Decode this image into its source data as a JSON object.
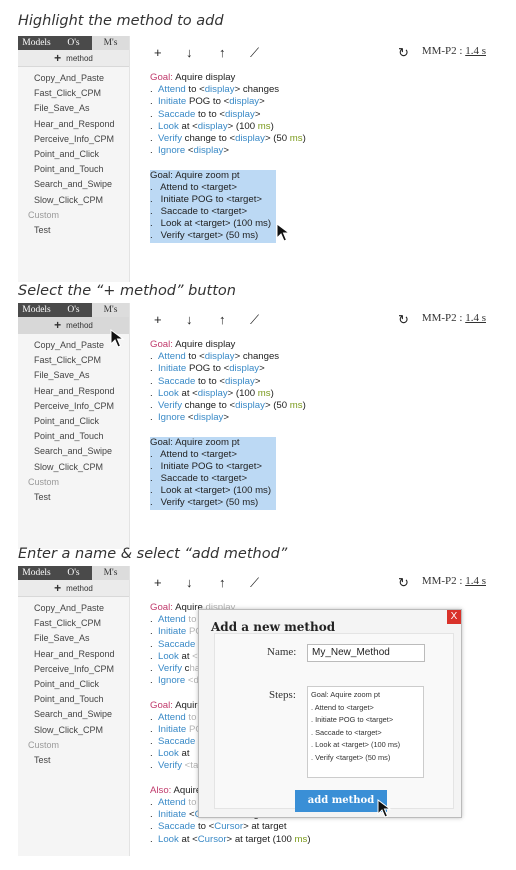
{
  "steps": [
    {
      "title": "Highlight the method to add"
    },
    {
      "title": "Select the “+ method” button"
    },
    {
      "title": "Enter a name & select “add method”"
    }
  ],
  "sidebar": {
    "tabs": [
      "Models",
      "O's",
      "M's"
    ],
    "add_method_label": "method",
    "methods": [
      "Copy_And_Paste",
      "Fast_Click_CPM",
      "File_Save_As",
      "Hear_and_Respond",
      "Perceive_Info_CPM",
      "Point_and_Click",
      "Point_and_Touch",
      "Search_and_Swipe",
      "Slow_Click_CPM"
    ],
    "custom_label": "Custom",
    "custom_items": [
      "Test"
    ]
  },
  "toolbar": {
    "icons": [
      "plus-icon",
      "arrow-down-icon",
      "arrow-up-icon",
      "pencil-icon",
      "refresh-icon"
    ],
    "model_label": "MM-P2",
    "model_time": "1.4 s"
  },
  "editor": {
    "goal1": "Aquire display",
    "goal2": "Aquire zoom pt",
    "goal3": "Aquire",
    "goal_kw": "Goal:",
    "also_kw": "Also:"
  },
  "modal": {
    "title": "Add a new method",
    "close": "X",
    "name_label": "Name:",
    "name_value": "My_New_Method",
    "steps_label": "Steps:",
    "steps_lines": [
      "Goal: Aquire zoom pt",
      ". Attend to <target>",
      ". Initiate POG to <target>",
      ". Saccade to <target>",
      ". Look at <target> (100 ms)",
      ". Verify <target> (50 ms)"
    ],
    "add_button": "add method"
  }
}
